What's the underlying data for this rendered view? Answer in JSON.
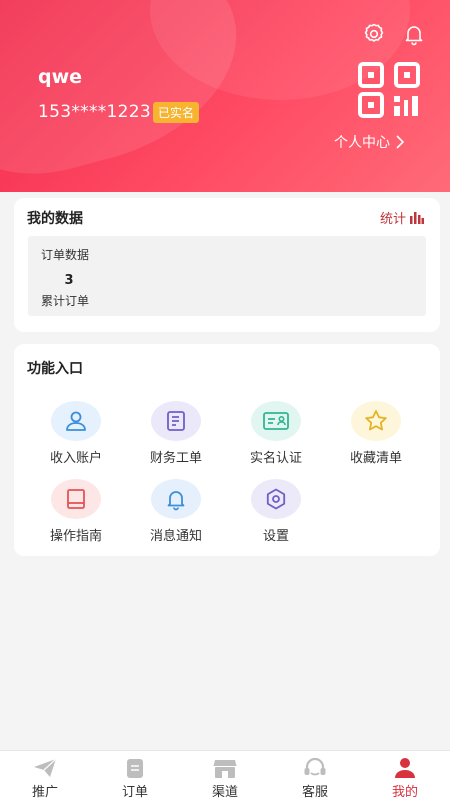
{
  "header": {
    "username": "qwe",
    "phone": "153****1223",
    "verified_badge": "已实名",
    "personal_center": "个人中心"
  },
  "my_data": {
    "title": "我的数据",
    "stats_label": "统计",
    "order_data_title": "订单数据",
    "order_count": "3",
    "order_count_label": "累计订单"
  },
  "functions": {
    "title": "功能入口",
    "items": [
      {
        "label": "收入账户",
        "icon": "user-icon",
        "bg": "#e5f1fc",
        "color": "#3a8fdc"
      },
      {
        "label": "财务工单",
        "icon": "document-list-icon",
        "bg": "#ebe9f9",
        "color": "#6f5fc8"
      },
      {
        "label": "实名认证",
        "icon": "id-card-icon",
        "bg": "#e2f6f1",
        "color": "#33b592"
      },
      {
        "label": "收藏清单",
        "icon": "star-icon",
        "bg": "#fdf6db",
        "color": "#e3b423"
      },
      {
        "label": "操作指南",
        "icon": "book-icon",
        "bg": "#fde6e6",
        "color": "#e45357"
      },
      {
        "label": "消息通知",
        "icon": "bell-icon",
        "bg": "#e6f0fc",
        "color": "#3a8fdc"
      },
      {
        "label": "设置",
        "icon": "hexagon-settings-icon",
        "bg": "#ece9f9",
        "color": "#6f5fc8"
      }
    ]
  },
  "tabbar": {
    "items": [
      {
        "label": "推广",
        "icon": "paper-plane-icon"
      },
      {
        "label": "订单",
        "icon": "clipboard-icon"
      },
      {
        "label": "渠道",
        "icon": "store-icon"
      },
      {
        "label": "客服",
        "icon": "headset-icon"
      },
      {
        "label": "我的",
        "icon": "person-icon",
        "active": true
      }
    ]
  },
  "colors": {
    "brand": "#f0294b",
    "badge": "#f7b430",
    "active_tab": "#d8323f"
  }
}
